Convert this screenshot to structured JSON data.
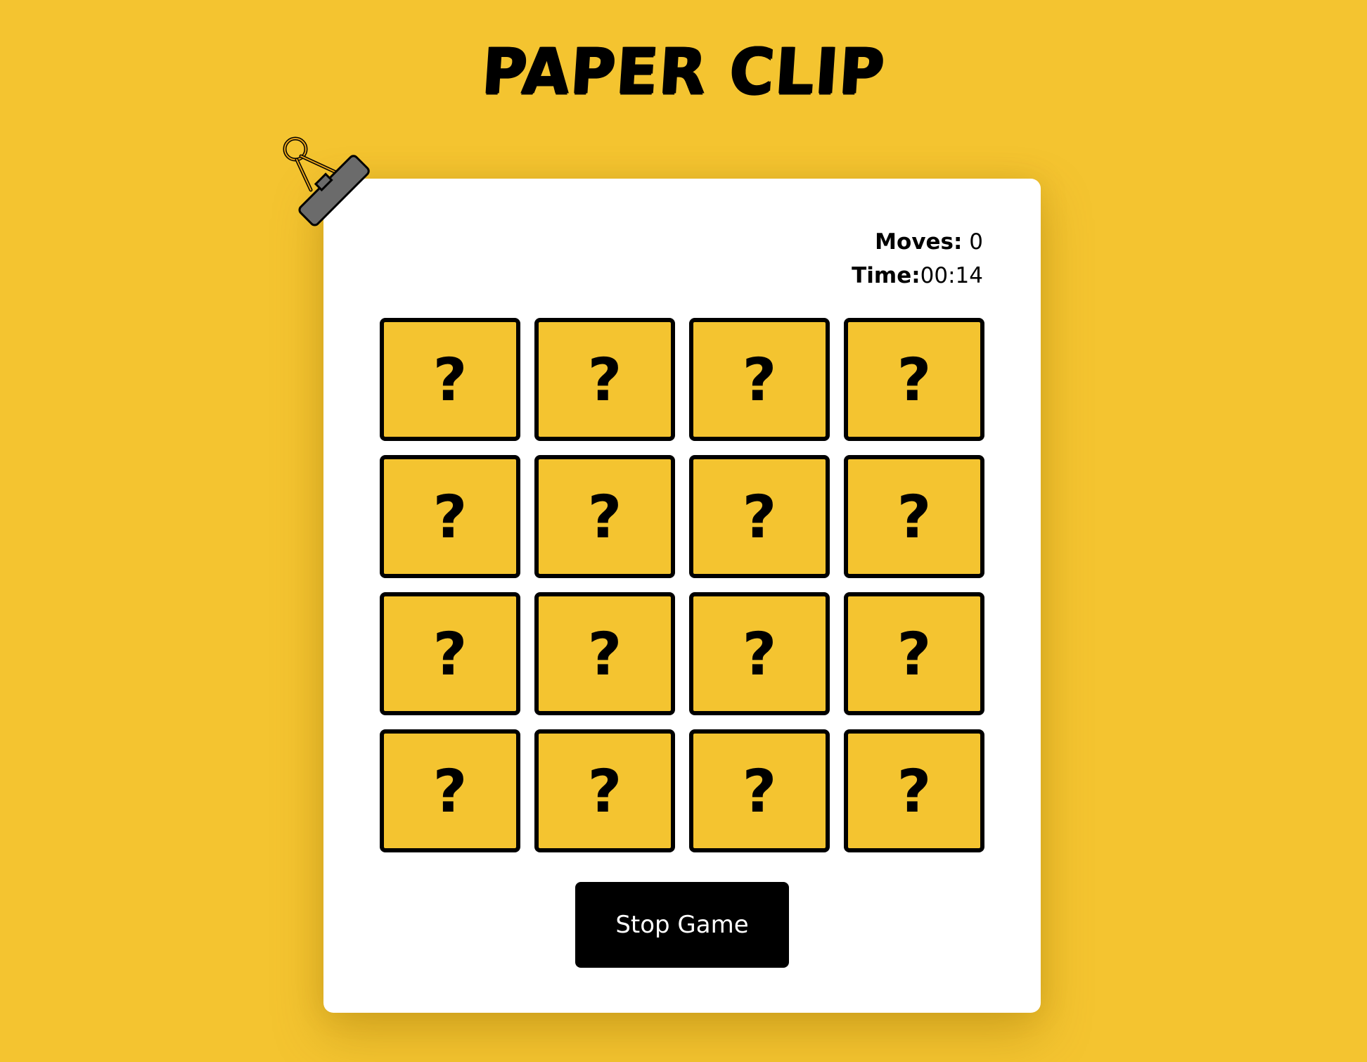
{
  "app": {
    "title": "PAPER CLIP"
  },
  "stats": {
    "moves_label": "Moves:",
    "moves_value": "0",
    "time_label": "Time:",
    "time_value": "00:14"
  },
  "tiles": [
    "?",
    "?",
    "?",
    "?",
    "?",
    "?",
    "?",
    "?",
    "?",
    "?",
    "?",
    "?",
    "?",
    "?",
    "?",
    "?"
  ],
  "controls": {
    "stop_label": "Stop Game"
  },
  "colors": {
    "background": "#F4C430",
    "panel": "#FFFFFF",
    "tile": "#F4C430",
    "tile_border": "#000000",
    "button": "#000000",
    "clip": "#6B6B6B"
  },
  "icons": {
    "clip": "binder-clip-icon"
  }
}
